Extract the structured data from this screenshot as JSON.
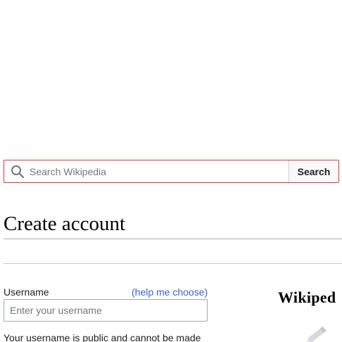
{
  "search": {
    "placeholder": "Search Wikipedia",
    "button_label": "Search",
    "icon": "search-icon",
    "border_color": "#d33333"
  },
  "heading": {
    "title": "Create account"
  },
  "form": {
    "username_label": "Username",
    "help_link": "(help me choose)",
    "username_placeholder": "Enter your username",
    "username_note": "Your username is public and cannot be made"
  },
  "promo": {
    "brand_text": "Wikiped",
    "icon": "pencil-icon"
  },
  "colors": {
    "link": "#3366cc",
    "text": "#202122",
    "placeholder": "#72777d"
  }
}
